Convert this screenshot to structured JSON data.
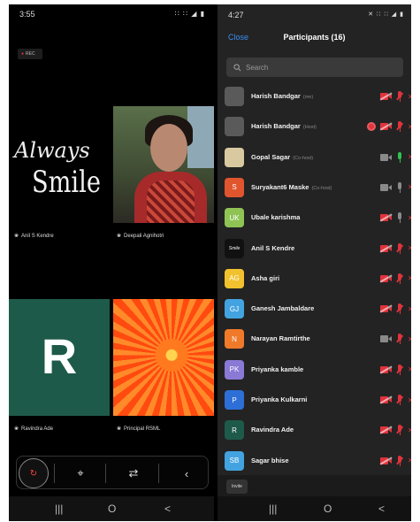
{
  "left": {
    "status_time": "3:55",
    "status_icons": "∷ ∷ ◢ ▮",
    "rec_badge": "REC",
    "rec_dot": "●",
    "tiles": {
      "anil": {
        "line1": "Always",
        "line2": "Smile",
        "name": "Anil S Kendre"
      },
      "deepali": {
        "name": "Deepali Agnihotri"
      },
      "ravindra": {
        "letter": "R",
        "name": "Ravindra Ade"
      },
      "principal": {
        "name": "Principal RSML"
      }
    },
    "name_mic_glyph": "❀",
    "toolbar": {
      "avatar_glyph": "↻",
      "focus_glyph": "⌖",
      "switch_glyph": "⇄",
      "share_glyph": "‹"
    },
    "nav": {
      "recent": "|||",
      "home": "O",
      "back": "<"
    }
  },
  "right": {
    "status_time": "4:27",
    "status_icons": "✕ ∷ ∷ ◢ ▮",
    "close_label": "Close",
    "title": "Participants (16)",
    "search_placeholder": "Search",
    "search_icon": "search-icon",
    "participants": [
      {
        "name": "Harish Bandgar",
        "role": "(me)",
        "avatar_color": "#5a5a5a",
        "avatar_text": "",
        "cam": "red",
        "mic": "red",
        "recording": false
      },
      {
        "name": "Harish Bandgar",
        "role": "(Host)",
        "avatar_color": "#5a5a5a",
        "avatar_text": "",
        "cam": "red",
        "mic": "red",
        "recording": true
      },
      {
        "name": "Gopal Sagar",
        "role": "(Co-host)",
        "avatar_color": "#d9c9a0",
        "avatar_text": "",
        "cam": "gray",
        "mic": "green",
        "recording": false
      },
      {
        "name": "Suryakant6 Maske",
        "role": "(Co-host)",
        "avatar_color": "#e0552e",
        "avatar_text": "S",
        "cam": "gray",
        "mic": "gray",
        "recording": false
      },
      {
        "name": "Ubale karishma",
        "role": "",
        "avatar_color": "#8fc455",
        "avatar_text": "UK",
        "cam": "red",
        "mic": "gray",
        "recording": false
      },
      {
        "name": "Anil S Kendre",
        "role": "",
        "avatar_color": "#111111",
        "avatar_text": "Smile",
        "cam": "red",
        "mic": "red",
        "recording": false
      },
      {
        "name": "Asha giri",
        "role": "",
        "avatar_color": "#f2c12e",
        "avatar_text": "AG",
        "cam": "red",
        "mic": "red",
        "recording": false
      },
      {
        "name": "Ganesh Jambaldare",
        "role": "",
        "avatar_color": "#43a3e0",
        "avatar_text": "GJ",
        "cam": "red",
        "mic": "red",
        "recording": false
      },
      {
        "name": "Narayan Ramtirthe",
        "role": "",
        "avatar_color": "#f07a2a",
        "avatar_text": "N",
        "cam": "gray",
        "mic": "red",
        "recording": false
      },
      {
        "name": "Priyanka kamble",
        "role": "",
        "avatar_color": "#8a7ad6",
        "avatar_text": "PK",
        "cam": "red",
        "mic": "red",
        "recording": false
      },
      {
        "name": "Priyanka Kulkarni",
        "role": "",
        "avatar_color": "#2d6fd6",
        "avatar_text": "P",
        "cam": "red",
        "mic": "red",
        "recording": false
      },
      {
        "name": "Ravindra Ade",
        "role": "",
        "avatar_color": "#1e5a4a",
        "avatar_text": "R",
        "cam": "red",
        "mic": "red",
        "recording": false
      },
      {
        "name": "Sagar bhise",
        "role": "",
        "avatar_color": "#43a3e0",
        "avatar_text": "SB",
        "cam": "red",
        "mic": "red",
        "recording": false
      }
    ],
    "invite_label": "Invite",
    "nav": {
      "recent": "|||",
      "home": "O",
      "back": "<"
    }
  }
}
